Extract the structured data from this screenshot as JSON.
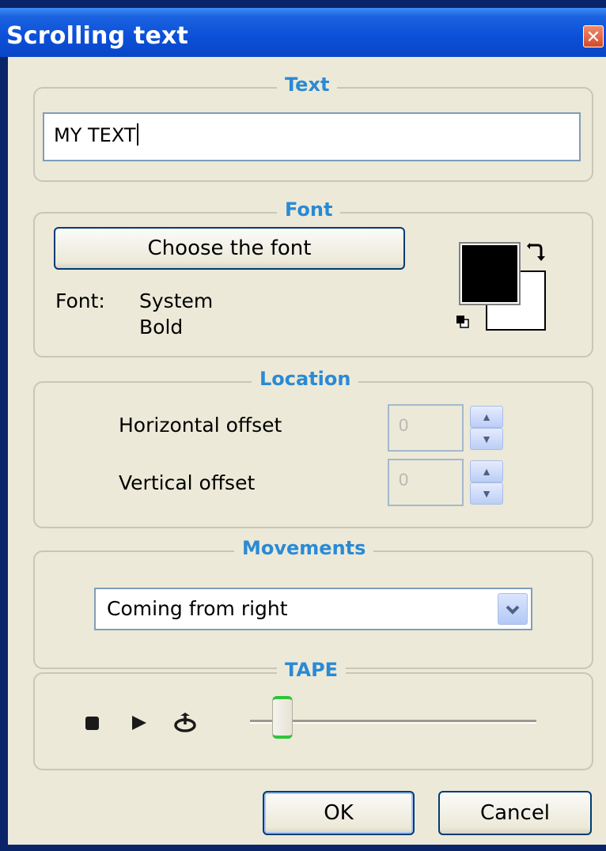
{
  "window": {
    "title": "Scrolling text",
    "close_glyph": "✕"
  },
  "text_group": {
    "legend": "Text",
    "value": "MY TEXT"
  },
  "font_group": {
    "legend": "Font",
    "choose_button": "Choose the font",
    "font_label": "Font:",
    "font_name": "System",
    "font_style": "Bold",
    "foreground_color": "#000000",
    "background_color": "#ffffff"
  },
  "location_group": {
    "legend": "Location",
    "horizontal_label": "Horizontal offset",
    "horizontal_value": "0",
    "vertical_label": "Vertical offset",
    "vertical_value": "0"
  },
  "movements_group": {
    "legend": "Movements",
    "selected": "Coming from right"
  },
  "tape_group": {
    "legend": "TAPE",
    "slider_position": 0.08
  },
  "buttons": {
    "ok": "OK",
    "cancel": "Cancel"
  },
  "colors": {
    "legend": "#2a8ad4",
    "titlebar": "#0b4fd8",
    "dialog_bg": "#ece9d8"
  }
}
